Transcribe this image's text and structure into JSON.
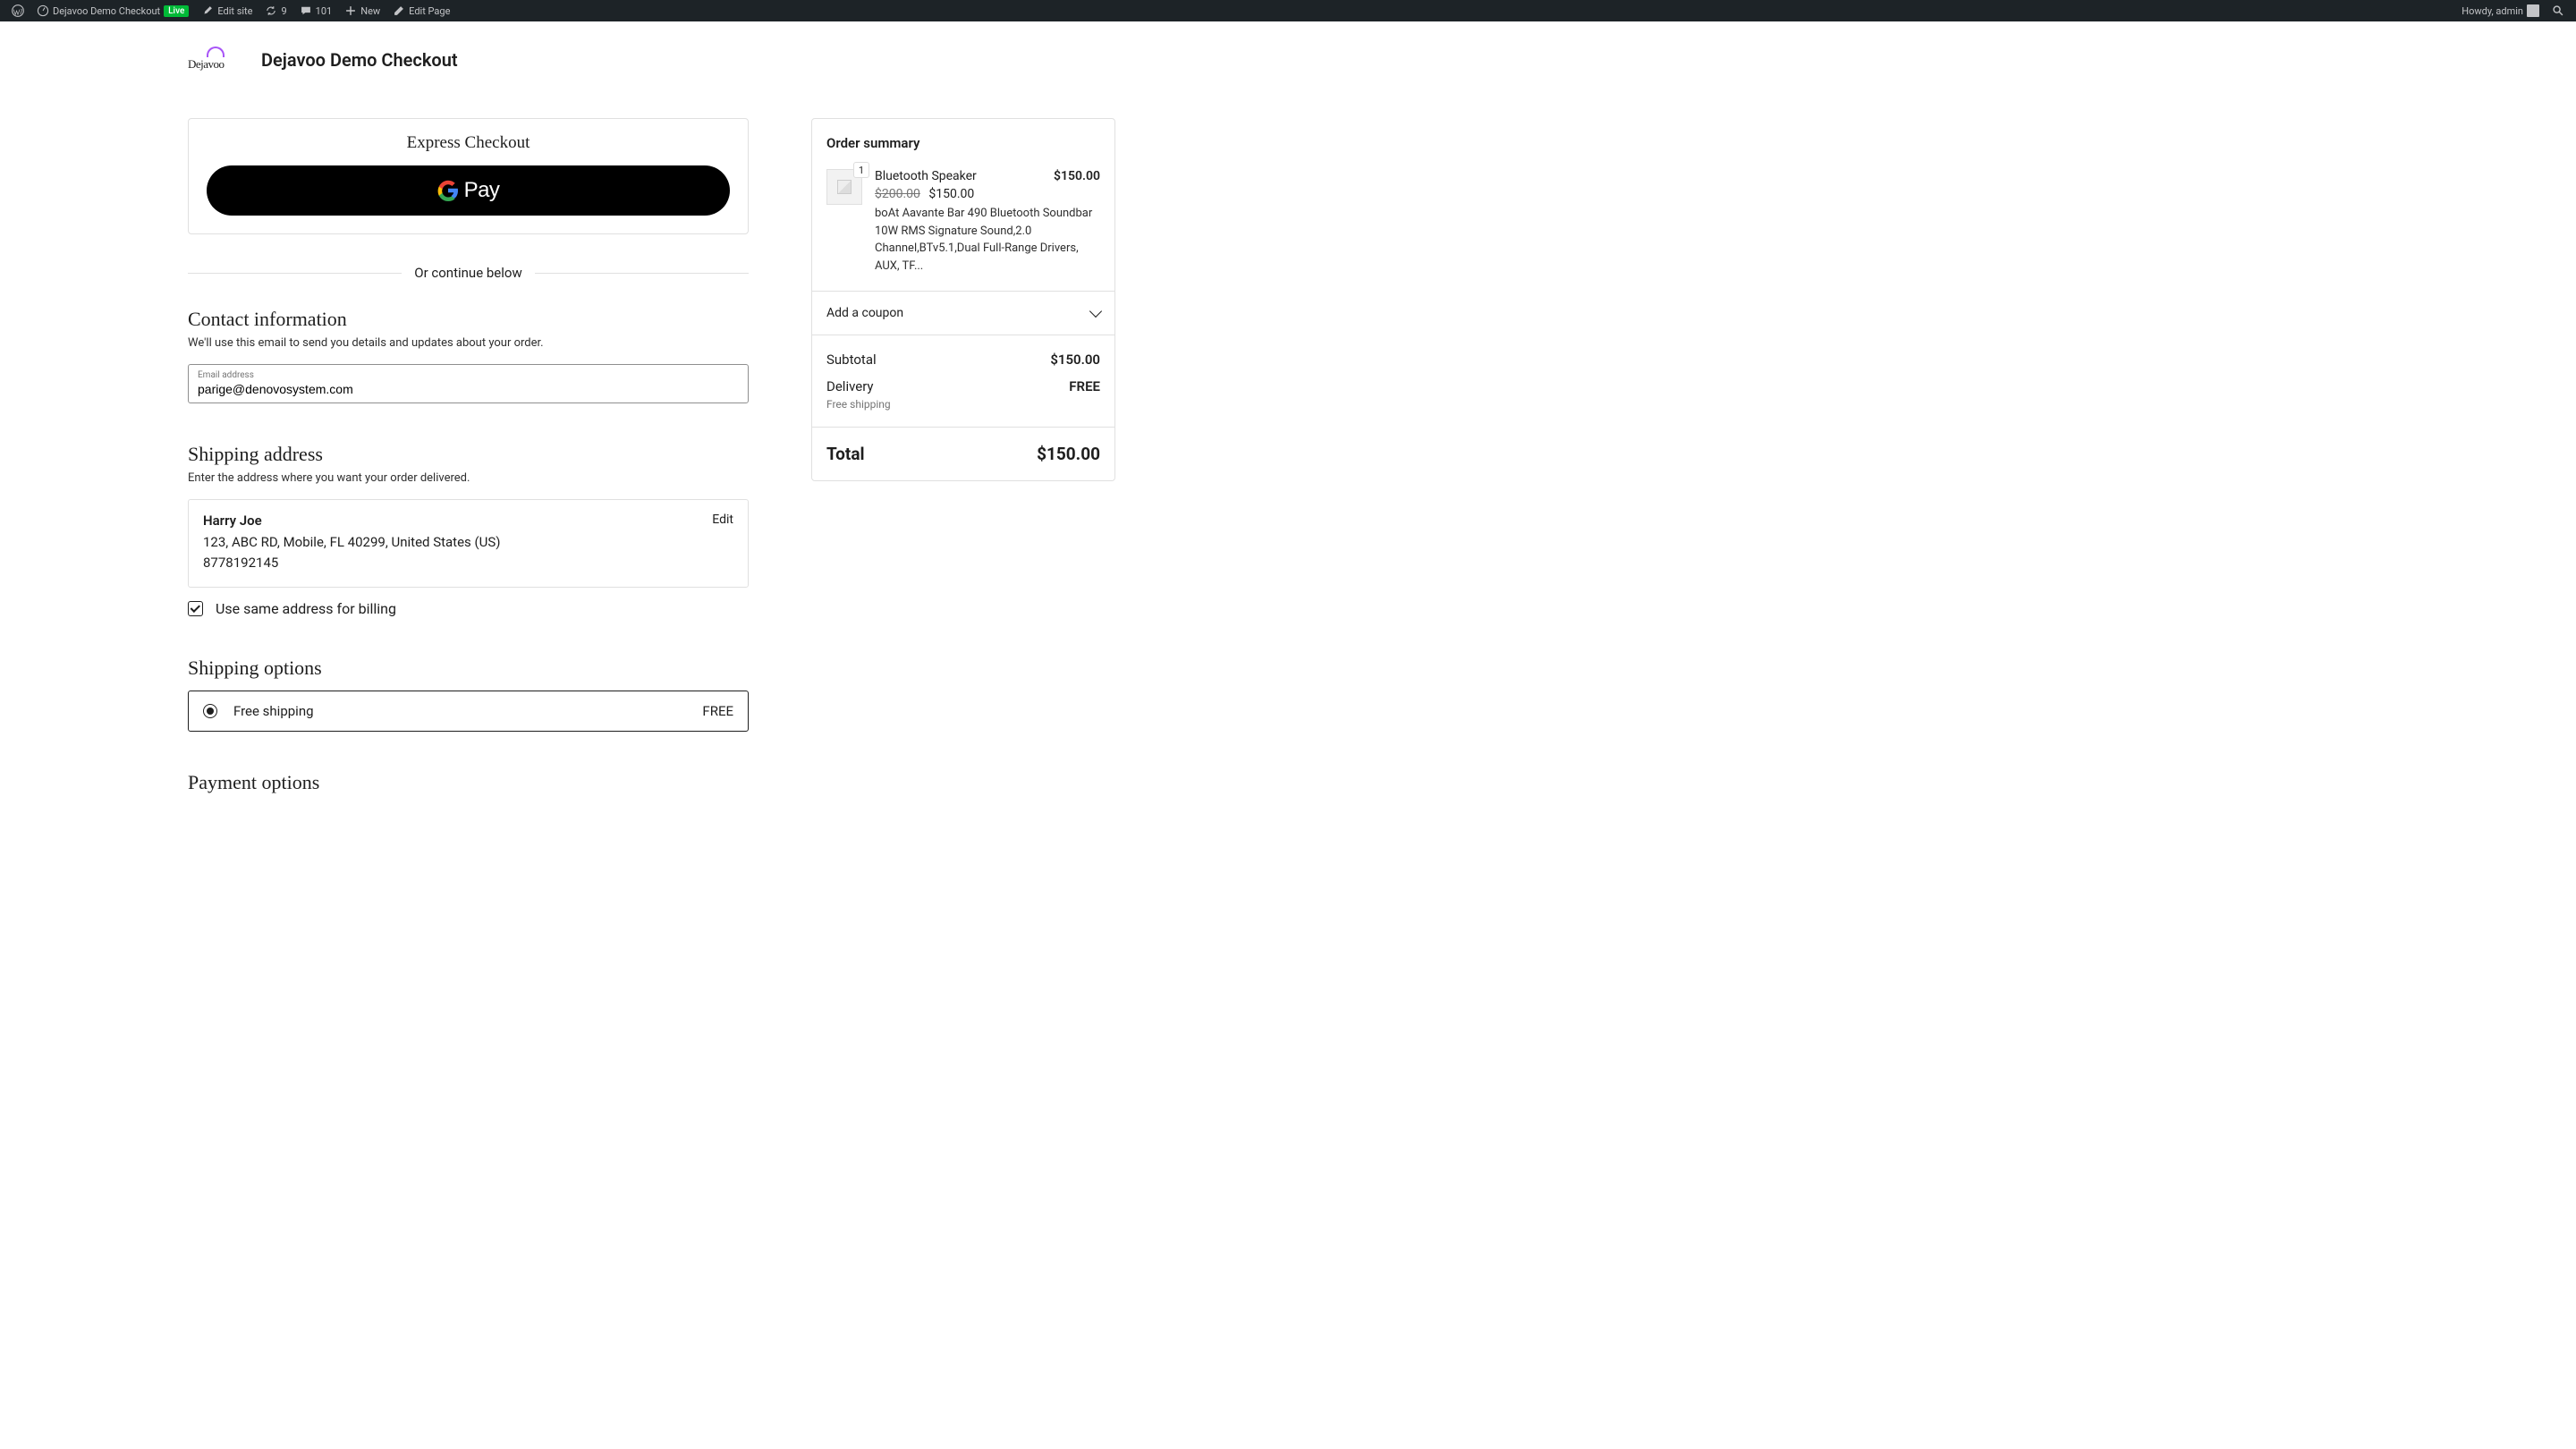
{
  "adminBar": {
    "siteName": "Dejavoo Demo Checkout",
    "liveBadge": "Live",
    "editSite": "Edit site",
    "updates": "9",
    "comments": "101",
    "new": "New",
    "editPage": "Edit Page",
    "howdy": "Howdy, admin"
  },
  "header": {
    "logoText": "Dejavoo",
    "title": "Dejavoo Demo Checkout"
  },
  "express": {
    "title": "Express Checkout",
    "gpayText": "Pay"
  },
  "divider": {
    "text": "Or continue below"
  },
  "contact": {
    "title": "Contact information",
    "desc": "We'll use this email to send you details and updates about your order.",
    "emailLabel": "Email address",
    "emailValue": "parige@denovosystem.com"
  },
  "shipping": {
    "title": "Shipping address",
    "desc": "Enter the address where you want your order delivered.",
    "name": "Harry Joe",
    "address": "123, ABC RD, Mobile, FL 40299, United States (US)",
    "phone": "8778192145",
    "edit": "Edit",
    "billingCheck": "Use same address for billing"
  },
  "shipOptions": {
    "title": "Shipping options",
    "option1Label": "Free shipping",
    "option1Price": "FREE"
  },
  "payment": {
    "title": "Payment options"
  },
  "summary": {
    "title": "Order summary",
    "qty": "1",
    "productName": "Bluetooth Speaker",
    "productTotal": "$150.00",
    "oldPrice": "$200.00",
    "newPrice": "$150.00",
    "productDesc": "boAt Aavante Bar 490 Bluetooth Soundbar 10W RMS Signature Sound,2.0 Channel,BTv5.1,Dual Full-Range Drivers, AUX, TF...",
    "coupon": "Add a coupon",
    "subtotalLabel": "Subtotal",
    "subtotalValue": "$150.00",
    "deliveryLabel": "Delivery",
    "deliveryValue": "FREE",
    "deliverySub": "Free shipping",
    "totalLabel": "Total",
    "totalValue": "$150.00"
  }
}
